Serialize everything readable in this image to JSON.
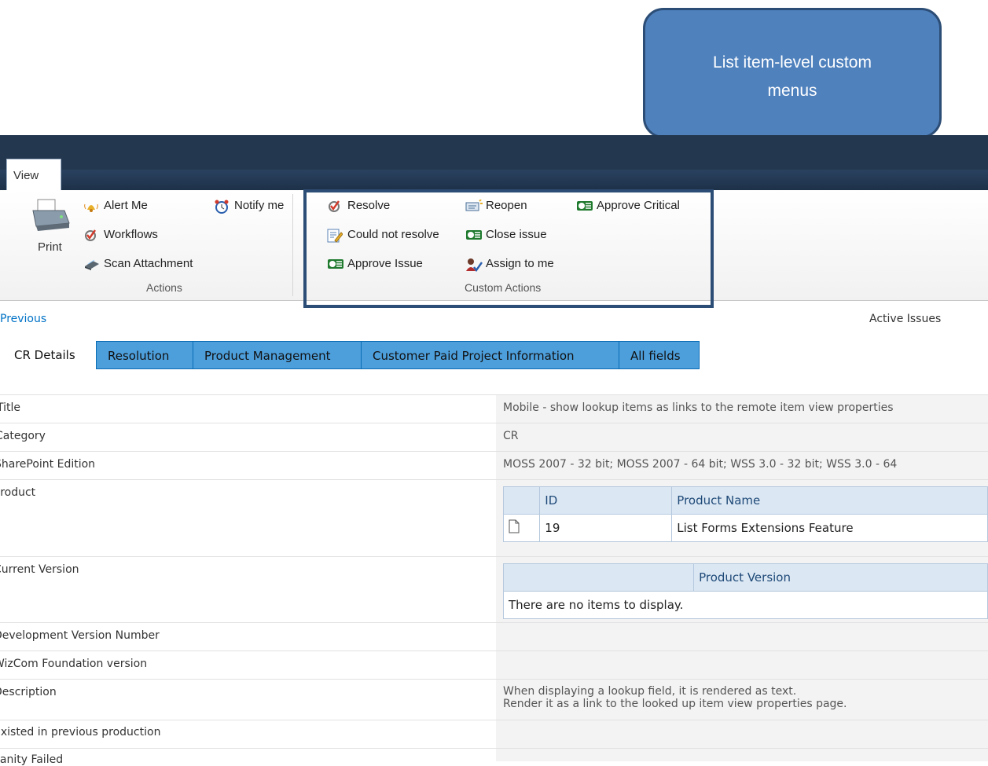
{
  "callout": {
    "line1": "List item-level custom",
    "line2": "menus"
  },
  "ribbon": {
    "tab_view": "View",
    "actions": {
      "print": "Print",
      "alert_me": "Alert Me",
      "workflows": "Workflows",
      "scan_attachment": "Scan Attachment",
      "notify_me": "Notify me",
      "group_label": "Actions"
    },
    "custom_actions": {
      "resolve": "Resolve",
      "reopen": "Reopen",
      "approve_critical": "Approve Critical",
      "could_not_resolve": "Could not resolve",
      "close_issue": "Close issue",
      "approve_issue": "Approve Issue",
      "assign_to_me": "Assign to me",
      "group_label": "Custom Actions"
    }
  },
  "nav": {
    "previous": "Previous",
    "list_name": "Active Issues"
  },
  "form_tabs": [
    "CR Details",
    "Resolution",
    "Product Management",
    "Customer Paid Project Information",
    "All fields"
  ],
  "fields": {
    "title_label": "Title",
    "title_value": "Mobile - show lookup items as links to the remote item view properties",
    "category_label": "Category",
    "category_value": "CR",
    "edition_label": "SharePoint Edition",
    "edition_value": "MOSS 2007 - 32 bit; MOSS 2007 - 64 bit; WSS 3.0 - 32 bit; WSS 3.0 - 64",
    "product_label": "Product",
    "product_table": {
      "col_id": "ID",
      "col_name": "Product Name",
      "row_id": "19",
      "row_name": "List Forms Extensions Feature"
    },
    "current_version_label": "Current Version",
    "version_table": {
      "col": "Product Version",
      "empty": "There are no items to display."
    },
    "dev_version_label": "Development Version Number",
    "wizcom_label": "WizCom Foundation version",
    "description_label": "Description",
    "description_line1": "When displaying a lookup field, it is rendered as text.",
    "description_line2": "Render it as a link to the looked up item view properties page.",
    "existed_label": "Existed in previous production",
    "sanity_label": "Sanity Failed"
  }
}
